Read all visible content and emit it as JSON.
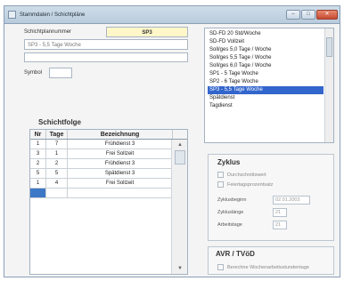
{
  "window": {
    "title": "Stammdaten / Schichtpläne",
    "min_label": "–",
    "max_label": "□",
    "close_label": "✕"
  },
  "form": {
    "plan_number_label": "Schichtplannummer",
    "plan_number_value": "SP3",
    "plan_name_value": "SP3 - 5,5 Tage Woche",
    "spare_value": "",
    "symbol_label": "Symbol",
    "symbol_value": ""
  },
  "schichtfolge": {
    "title": "Schichtfolge",
    "columns": [
      "Nr",
      "Tage",
      "Bezeichnung"
    ],
    "rows": [
      [
        "1",
        "7",
        "Frühdienst 3"
      ],
      [
        "3",
        "1",
        "Frei Sollzeit"
      ],
      [
        "2",
        "2",
        "Frühdienst 3"
      ],
      [
        "5",
        "5",
        "Spätdienst 3"
      ],
      [
        "1",
        "4",
        "Frei Sollzeit"
      ],
      [
        "",
        "",
        ""
      ]
    ],
    "scroll_up": "▲",
    "scroll_down": "▼"
  },
  "plan_list": {
    "items": [
      "SD-FD 20 Std/Woche",
      "SD-FD Vollzeit",
      "Soll/ges 5,0 Tage / Woche",
      "Soll/ges 5,5 Tage / Woche",
      "Soll/ges 6,0 Tage / Woche",
      "SP1 - 5 Tage Woche",
      "SP2 - 6 Tage Woche",
      "SP3 - 5,5 Tage Woche",
      "Spätdienst",
      "Tagdienst"
    ],
    "selected_index": 7
  },
  "zyklus": {
    "title": "Zyklus",
    "durchschnitt_label": "Durchschnittswert",
    "feiertag_label": "Feiertagsprozentsatz",
    "beginn_label": "Zyklusbeginn",
    "beginn_value": "02.01.2003",
    "laenge_label": "Zykluslänge",
    "laenge_value": "21",
    "arbeitstage_label": "Arbeitstage",
    "arbeitstage_value": "21"
  },
  "avr": {
    "title": "AVR / TVöD",
    "checkbox_label": "Berechne Wochenarbeitsstundentage"
  }
}
